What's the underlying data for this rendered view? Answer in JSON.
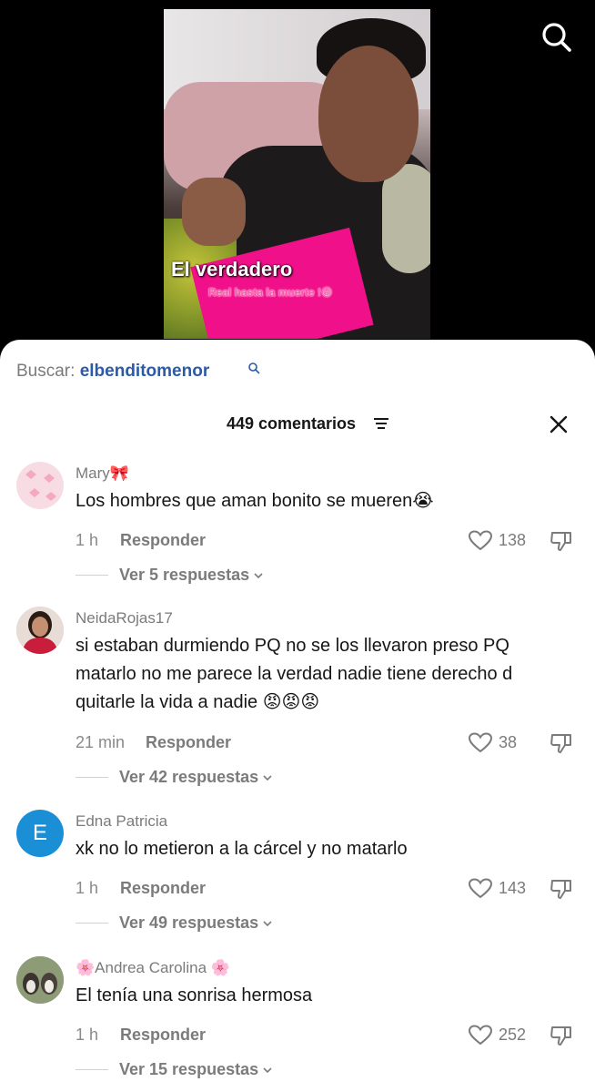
{
  "video": {
    "overlay_title": "El verdadero",
    "overlay_subtitle": "Real hasta la muerte !😁"
  },
  "search": {
    "label": "Buscar:",
    "term": "elbenditomenor"
  },
  "comments_header": {
    "count_label": "449 comentarios"
  },
  "comments": [
    {
      "username": "Mary🎀",
      "text": "Los hombres que aman bonito se mueren😭",
      "time": "1 h",
      "reply_label": "Responder",
      "likes": "138",
      "view_replies": "Ver 5 respuestas"
    },
    {
      "username": "NeidaRojas17",
      "text": "si estaban durmiendo PQ no se los llevaron preso PQ matarlo no me parece la verdad nadie tiene derecho d quitarle la vida a nadie 😡😡😡",
      "time": "21 min",
      "reply_label": "Responder",
      "likes": "38",
      "view_replies": "Ver 42 respuestas"
    },
    {
      "username": "Edna Patricia",
      "avatar_letter": "E",
      "text": "xk no lo metieron a la cárcel y no matarlo",
      "time": "1 h",
      "reply_label": "Responder",
      "likes": "143",
      "view_replies": "Ver 49 respuestas"
    },
    {
      "username": "🌸Andrea Carolina 🌸",
      "text": "El tenía una sonrisa hermosa",
      "time": "1 h",
      "reply_label": "Responder",
      "likes": "252",
      "view_replies": "Ver 15 respuestas"
    }
  ],
  "colors": {
    "accent_link": "#2b5aa7",
    "avatar_blue": "#1a8fd6",
    "muted_text": "#7b7b7b"
  },
  "icons": [
    "search-icon",
    "filter-icon",
    "close-icon",
    "heart-icon",
    "dislike-icon",
    "chevron-down-icon"
  ]
}
